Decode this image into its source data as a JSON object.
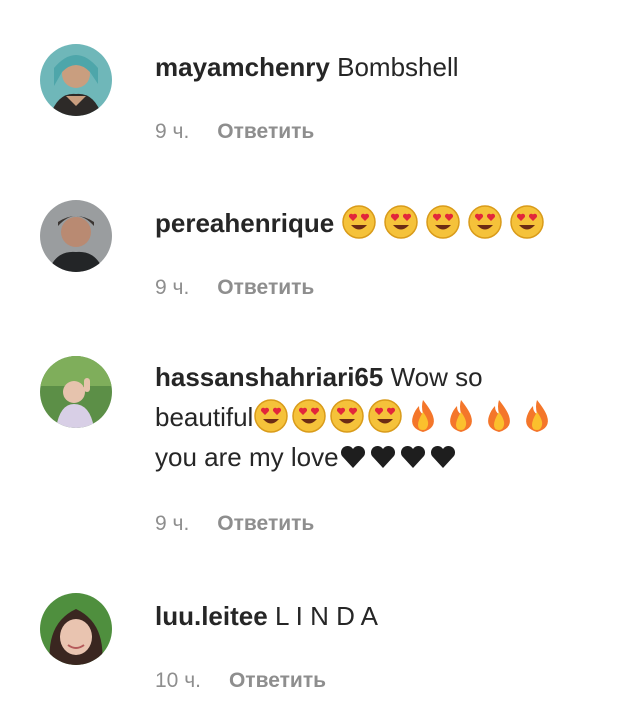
{
  "comments": [
    {
      "username": "mayamchenry",
      "text": "Bombshell",
      "time": "9 ч.",
      "reply": "Ответить",
      "avatar": "avatar-woman-teal-hair"
    },
    {
      "username": "pereahenrique",
      "text": "",
      "emojis": [
        "heart-eyes",
        "heart-eyes",
        "heart-eyes",
        "heart-eyes",
        "heart-eyes"
      ],
      "time": "9 ч.",
      "reply": "Ответить",
      "avatar": "avatar-man-cap"
    },
    {
      "username": "hassanshahriari65",
      "text": "Wow so",
      "text2": "beautiful",
      "text3": "you are my love",
      "emojis": [
        "heart-eyes",
        "heart-eyes",
        "heart-eyes",
        "heart-eyes",
        "fire",
        "fire",
        "fire",
        "fire"
      ],
      "hearts": [
        "black-heart",
        "black-heart",
        "black-heart",
        "black-heart"
      ],
      "time": "9 ч.",
      "reply": "Ответить",
      "avatar": "avatar-child-outdoor"
    },
    {
      "username": "luu.leitee",
      "text": "L I N D A",
      "time": "10 ч.",
      "reply": "Ответить",
      "avatar": "avatar-woman-dark-hair"
    }
  ]
}
